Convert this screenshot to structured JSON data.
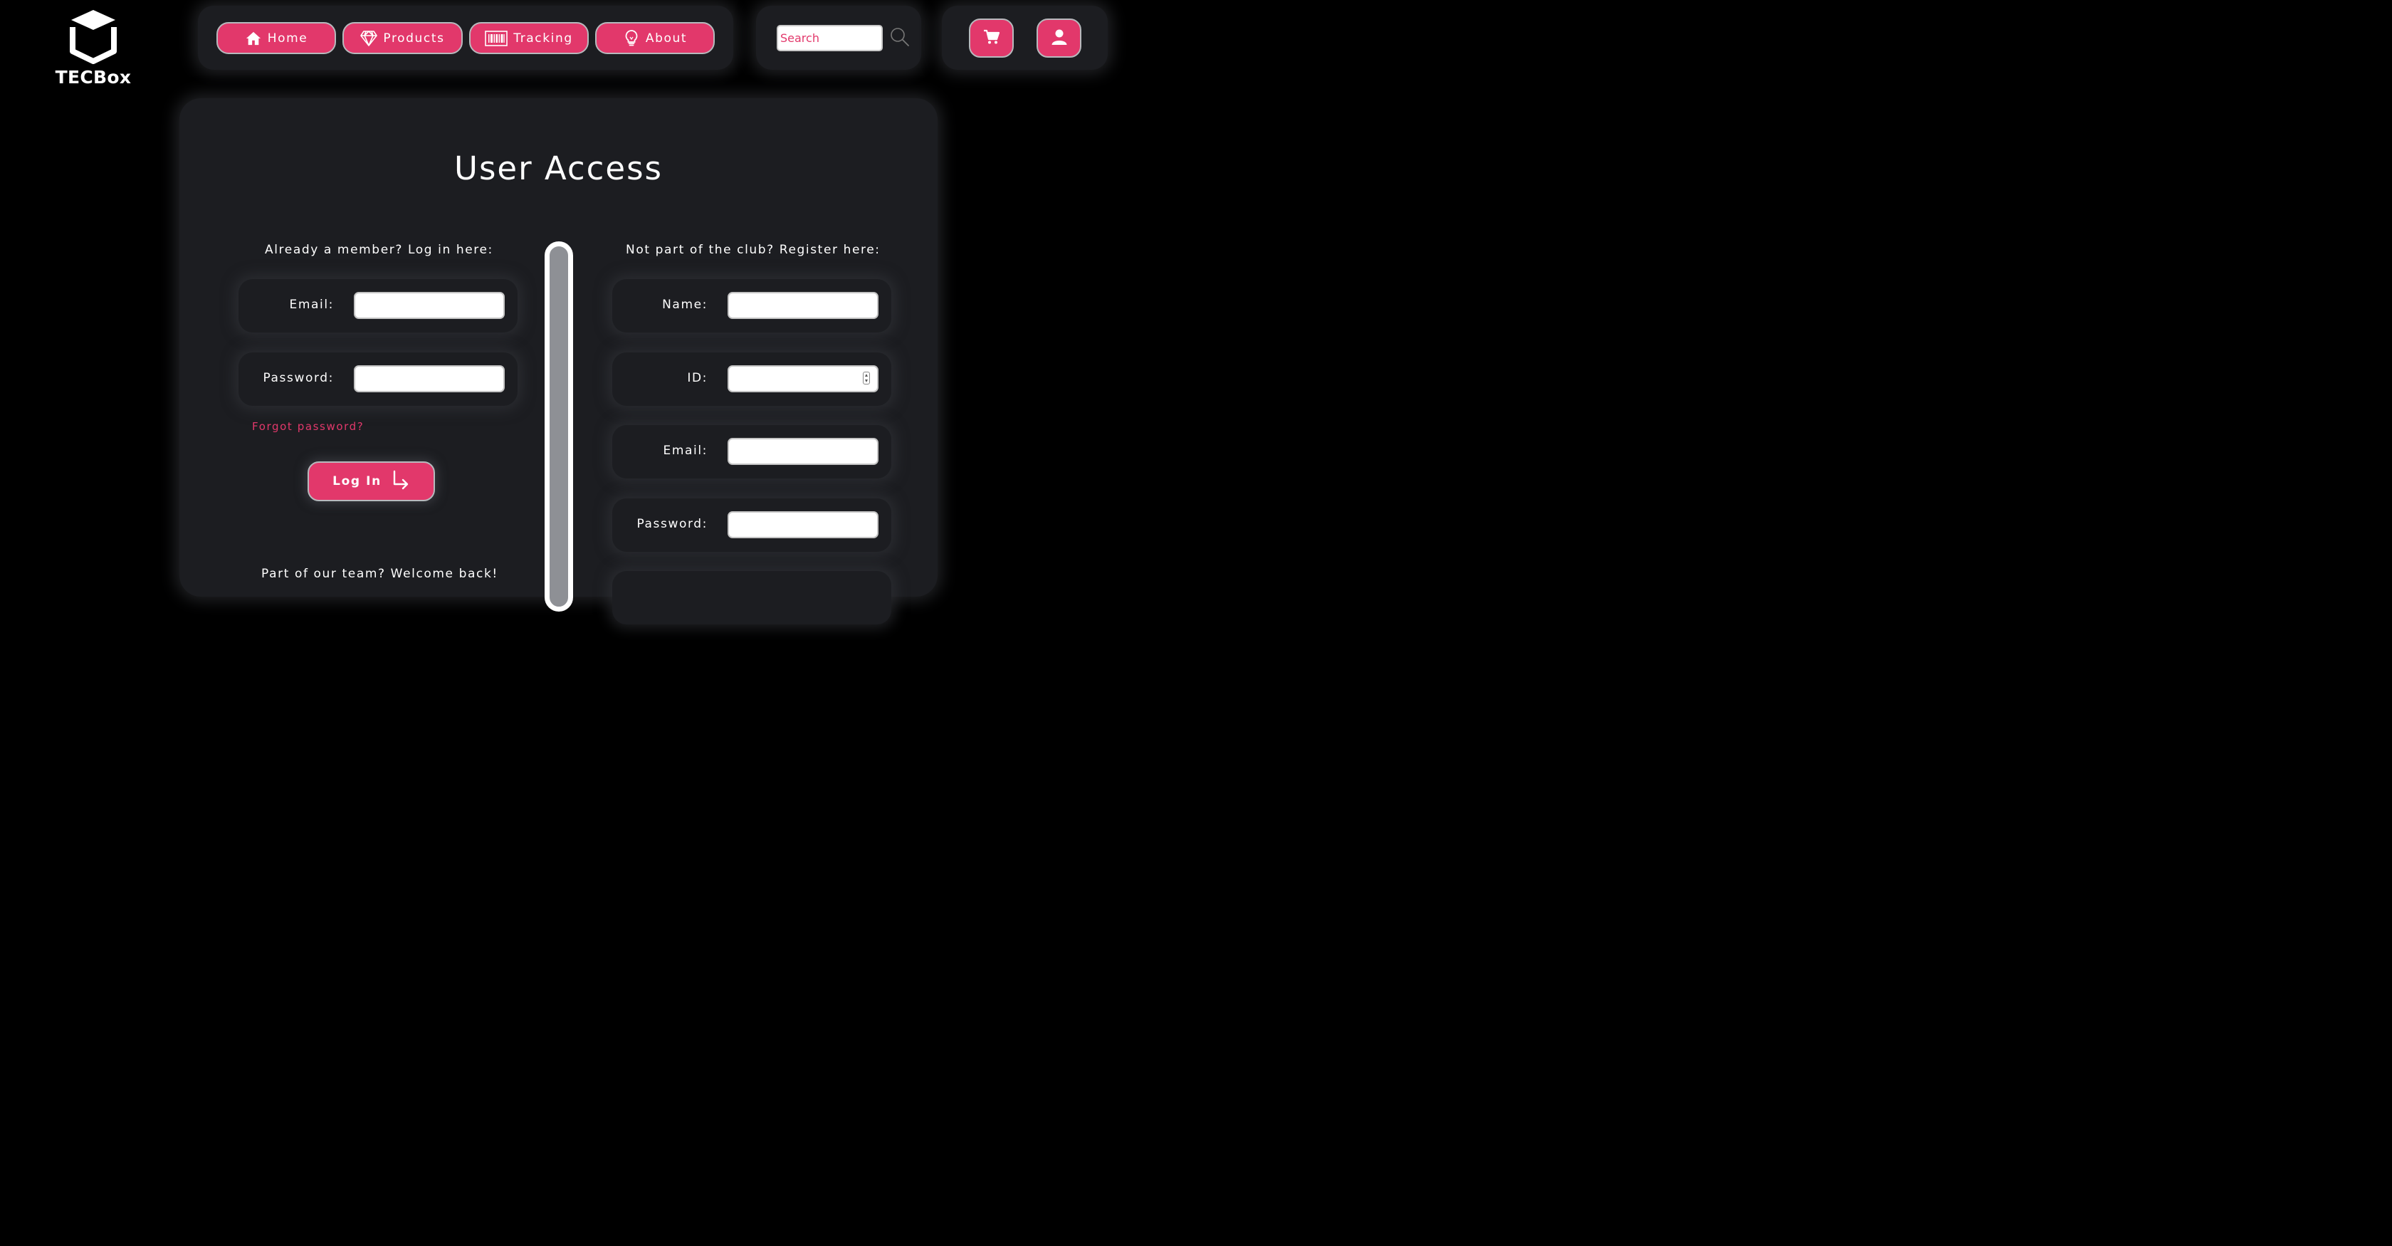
{
  "brand": {
    "name": "TECBox",
    "logo_icon": "open-box-icon"
  },
  "nav": {
    "items": [
      {
        "label": "Home",
        "icon": "home-icon"
      },
      {
        "label": "Products",
        "icon": "diamond-icon"
      },
      {
        "label": "Tracking",
        "icon": "barcode-icon"
      },
      {
        "label": "About",
        "icon": "lightbulb-icon"
      }
    ]
  },
  "search": {
    "placeholder": "Search",
    "value": "",
    "icon": "search-icon"
  },
  "header_icons": {
    "cart": "cart-icon",
    "account": "user-icon"
  },
  "page": {
    "title": "User Access"
  },
  "login": {
    "caption": "Already a member? Log in here:",
    "fields": [
      {
        "label": "Email:",
        "value": ""
      },
      {
        "label": "Password:",
        "value": ""
      }
    ],
    "forgot_link": "Forgot password?",
    "button_label": "Log In",
    "button_icon": "arrow-down-right-icon",
    "team_caption": "Part of our team? Welcome back!"
  },
  "register": {
    "caption": "Not part of the club? Register here:",
    "fields": [
      {
        "label": "Name:",
        "value": ""
      },
      {
        "label": "ID:",
        "value": ""
      },
      {
        "label": "Email:",
        "value": ""
      },
      {
        "label": "Password:",
        "value": ""
      }
    ]
  },
  "colors": {
    "accent": "#e2386b",
    "panel": "#1c1d21",
    "background": "#000000"
  }
}
